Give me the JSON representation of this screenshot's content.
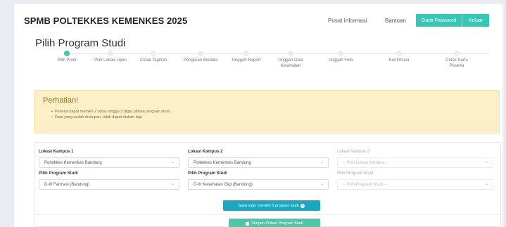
{
  "header": {
    "brand": "SPMB POLTEKKES KEMENKES 2025",
    "nav": {
      "info": "Pusat Informasi",
      "help": "Bantuan"
    },
    "buttons": {
      "change_password": "Ganti Password",
      "logout": "Keluar"
    }
  },
  "page_title": "Pilih Program Studi",
  "stepper": {
    "active_index": 0,
    "steps": [
      {
        "label": "Pilih Prodi"
      },
      {
        "label": "Pilih Lokasi Ujian"
      },
      {
        "label": "Cetak Tagihan"
      },
      {
        "label": "Pengisian Biodata"
      },
      {
        "label": "Unggah Raport"
      },
      {
        "label": "Unggah Data",
        "label2": "Kesehatan"
      },
      {
        "label": "Unggah Foto"
      },
      {
        "label": "Konfirmasi"
      },
      {
        "label": "Cetak Kartu",
        "label2": "Peserta"
      }
    ]
  },
  "alert": {
    "title": "Perhatian!",
    "items": [
      "Peserta dapat memilih 2 (dua) hingga 3 (tiga) pilihan program studi.",
      "Data yang sudah disimpan, tidak dapat diubah lagi."
    ]
  },
  "form": {
    "col1": {
      "campus_label": "Lokasi Kampus 1",
      "campus_value": "Poltekkes Kemenkes Bandung",
      "prodi_label": "Pilih Program Studi",
      "prodi_value": "D-III Farmasi (Bandung)"
    },
    "col2": {
      "campus_label": "Lokasi Kampus 2",
      "campus_value": "Poltekkes Kemenkes Bandung",
      "prodi_label": "Pilih Program Studi",
      "prodi_value": "D-III Kesehatan Gigi (Bandung)"
    },
    "col3": {
      "campus_label": "Lokasi Kampus 3",
      "campus_value": "-- Pilih Lokasi Kampus --",
      "prodi_label": "Pilih Program Studi",
      "prodi_value": "-- Pilih Program Studi --"
    },
    "add_button": "Saya ingin memilih 3 program studi",
    "save_button": "Simpan Pilihan Program Studi"
  },
  "colors": {
    "accent": "#34c7b5",
    "info": "#1aa7c2",
    "warning_bg": "#fdf0c9"
  },
  "icons": {
    "add": "plus-circle-icon",
    "save": "save-icon"
  }
}
